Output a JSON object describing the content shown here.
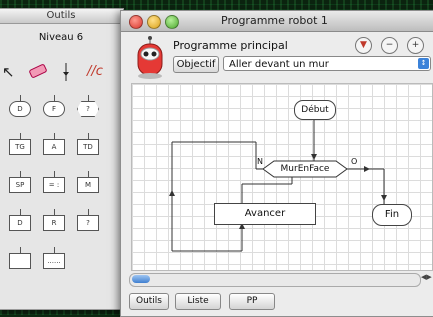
{
  "palette": {
    "title": "Outils",
    "level": "Niveau 6",
    "tools": {
      "slash_label": "//c"
    },
    "shapes": [
      {
        "label": "D",
        "kind": "oval"
      },
      {
        "label": "F",
        "kind": "oval"
      },
      {
        "label": "?",
        "kind": "diamond"
      },
      {
        "label": "TG",
        "kind": "rect"
      },
      {
        "label": "A",
        "kind": "rect"
      },
      {
        "label": "TD",
        "kind": "rect"
      },
      {
        "label": "SP",
        "kind": "rect"
      },
      {
        "label": "= :",
        "kind": "rect"
      },
      {
        "label": "M",
        "kind": "rect"
      },
      {
        "label": "D",
        "kind": "rect"
      },
      {
        "label": "R",
        "kind": "rect"
      },
      {
        "label": "?",
        "kind": "rect"
      },
      {
        "label": "",
        "kind": "rect"
      },
      {
        "label": "......",
        "kind": "rect"
      }
    ]
  },
  "window": {
    "title": "Programme robot 1",
    "program_title": "Programme principal",
    "objective_button": "Objectif",
    "objective_select": "Aller devant un mur",
    "flow": {
      "start": "Début",
      "condition": "MurEnFace",
      "branch_no": "N",
      "branch_yes": "O",
      "action": "Avancer",
      "end": "Fin"
    },
    "bottom_buttons": [
      "Outils",
      "Liste",
      "PP"
    ]
  },
  "colors": {
    "accent": "#3b82d9",
    "close": "#d8352b",
    "minimize": "#d9a21a",
    "zoom": "#4ca82d"
  }
}
